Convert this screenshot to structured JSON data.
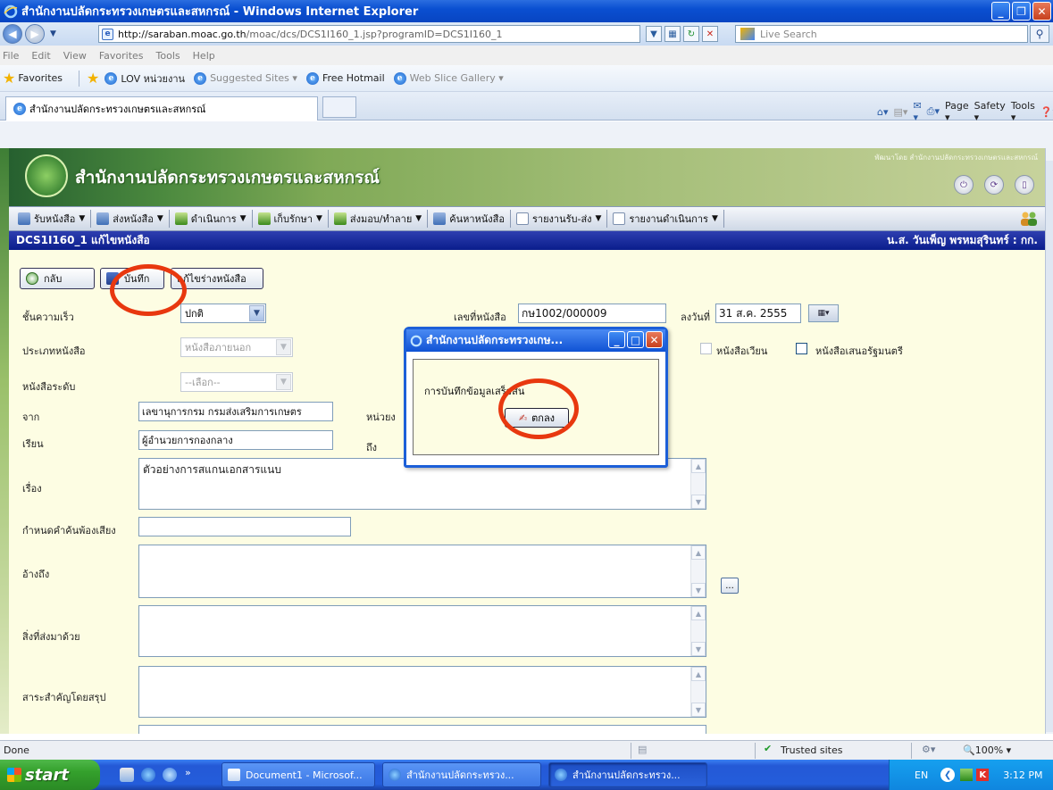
{
  "window": {
    "title": "สำนักงานปลัดกระทรวงเกษตรและสหกรณ์ - Windows Internet Explorer"
  },
  "address": {
    "url_host": "http://saraban.moac.go.th",
    "url_path": "/moac/dcs/DCS1I160_1.jsp?programID=DCS1I160_1",
    "search_placeholder": "Live Search"
  },
  "menubar": {
    "items": [
      "File",
      "Edit",
      "View",
      "Favorites",
      "Tools",
      "Help"
    ]
  },
  "favorites": {
    "label": "Favorites",
    "items": [
      "LOV หน่วยงาน",
      "Suggested Sites ▾",
      "Free Hotmail",
      "Web Slice Gallery ▾"
    ]
  },
  "tab": {
    "label": "สำนักงานปลัดกระทรวงเกษตรและสหกรณ์"
  },
  "commandbar": {
    "page": "Page ▾",
    "safety": "Safety ▾",
    "tools": "Tools ▾"
  },
  "banner": {
    "title": "สำนักงานปลัดกระทรวงเกษตรและสหกรณ์",
    "subtitle": "พัฒนาโดย สำนักงานปลัดกระทรวงเกษตรและสหกรณ์"
  },
  "appmenu": {
    "items": [
      "รับหนังสือ",
      "ส่งหนังสือ",
      "ดำเนินการ",
      "เก็บรักษา",
      "ส่งมอบ/ทำลาย",
      "ค้นหาหนังสือ",
      "รายงานรับ-ส่ง",
      "รายงานดำเนินการ"
    ]
  },
  "apptitle": {
    "screen": "DCS1I160_1 แก้ไขหนังสือ",
    "user": "น.ส. วันเพ็ญ พรหมสุรินทร์ : กก."
  },
  "toolbar": {
    "back": "กลับ",
    "save": "บันทึก",
    "draft": "แก้ไขร่างหนังสือ"
  },
  "form": {
    "speed_label": "ชั้นความเร็ว",
    "speed_value": "ปกติ",
    "doc_no_label": "เลขที่หนังสือ",
    "doc_no_value": "กษ1002/000009",
    "date_label": "ลงวันที่",
    "date_value": "31 ส.ค. 2555",
    "type_label": "ประเภทหนังสือ",
    "type_value": "หนังสือภายนอก",
    "level_label": "หนังสือระดับ",
    "level_value": "--เลือก--",
    "circular_label": "หนังสือเวียน",
    "cabinet_label": "หนังสือเสนอรัฐมนตรี",
    "from_label": "จาก",
    "from_value": "เลขานุการกรม กรมส่งเสริมการเกษตร",
    "unit_label": "หน่วยง",
    "to_label": "เรียน",
    "to_value": "ผู้อำนวยการกองกลาง",
    "to2_label": "ถึง",
    "subject_label": "เรื่อง",
    "subject_value": "ตัวอย่างการสแกนเอกสารแนบ",
    "keyword_label": "กำหนดคำค้นพ้องเสียง",
    "ref_label": "อ้างถึง",
    "attach_label": "สิ่งที่ส่งมาด้วย",
    "summary_label": "สาระสำคัญโดยสรุป",
    "dots": "..."
  },
  "dialog": {
    "title": "สำนักงานปลัดกระทรวงเกษ...",
    "message": "การบันทึกข้อมูลเสร็จสิ้น",
    "ok": "ตกลง"
  },
  "statusbar": {
    "status": "Done",
    "zone": "Trusted sites",
    "zoom": "100%"
  },
  "taskbar": {
    "start": "start",
    "tasks": [
      "Document1 - Microsof...",
      "สำนักงานปลัดกระทรวง...",
      "สำนักงานปลัดกระทรวง..."
    ],
    "lang": "EN",
    "clock": "3:12 PM"
  },
  "colors": {
    "highlight_circle": "#e8380f",
    "app_title_bg": "#0a1d8c",
    "form_bg": "#fdfde3"
  }
}
